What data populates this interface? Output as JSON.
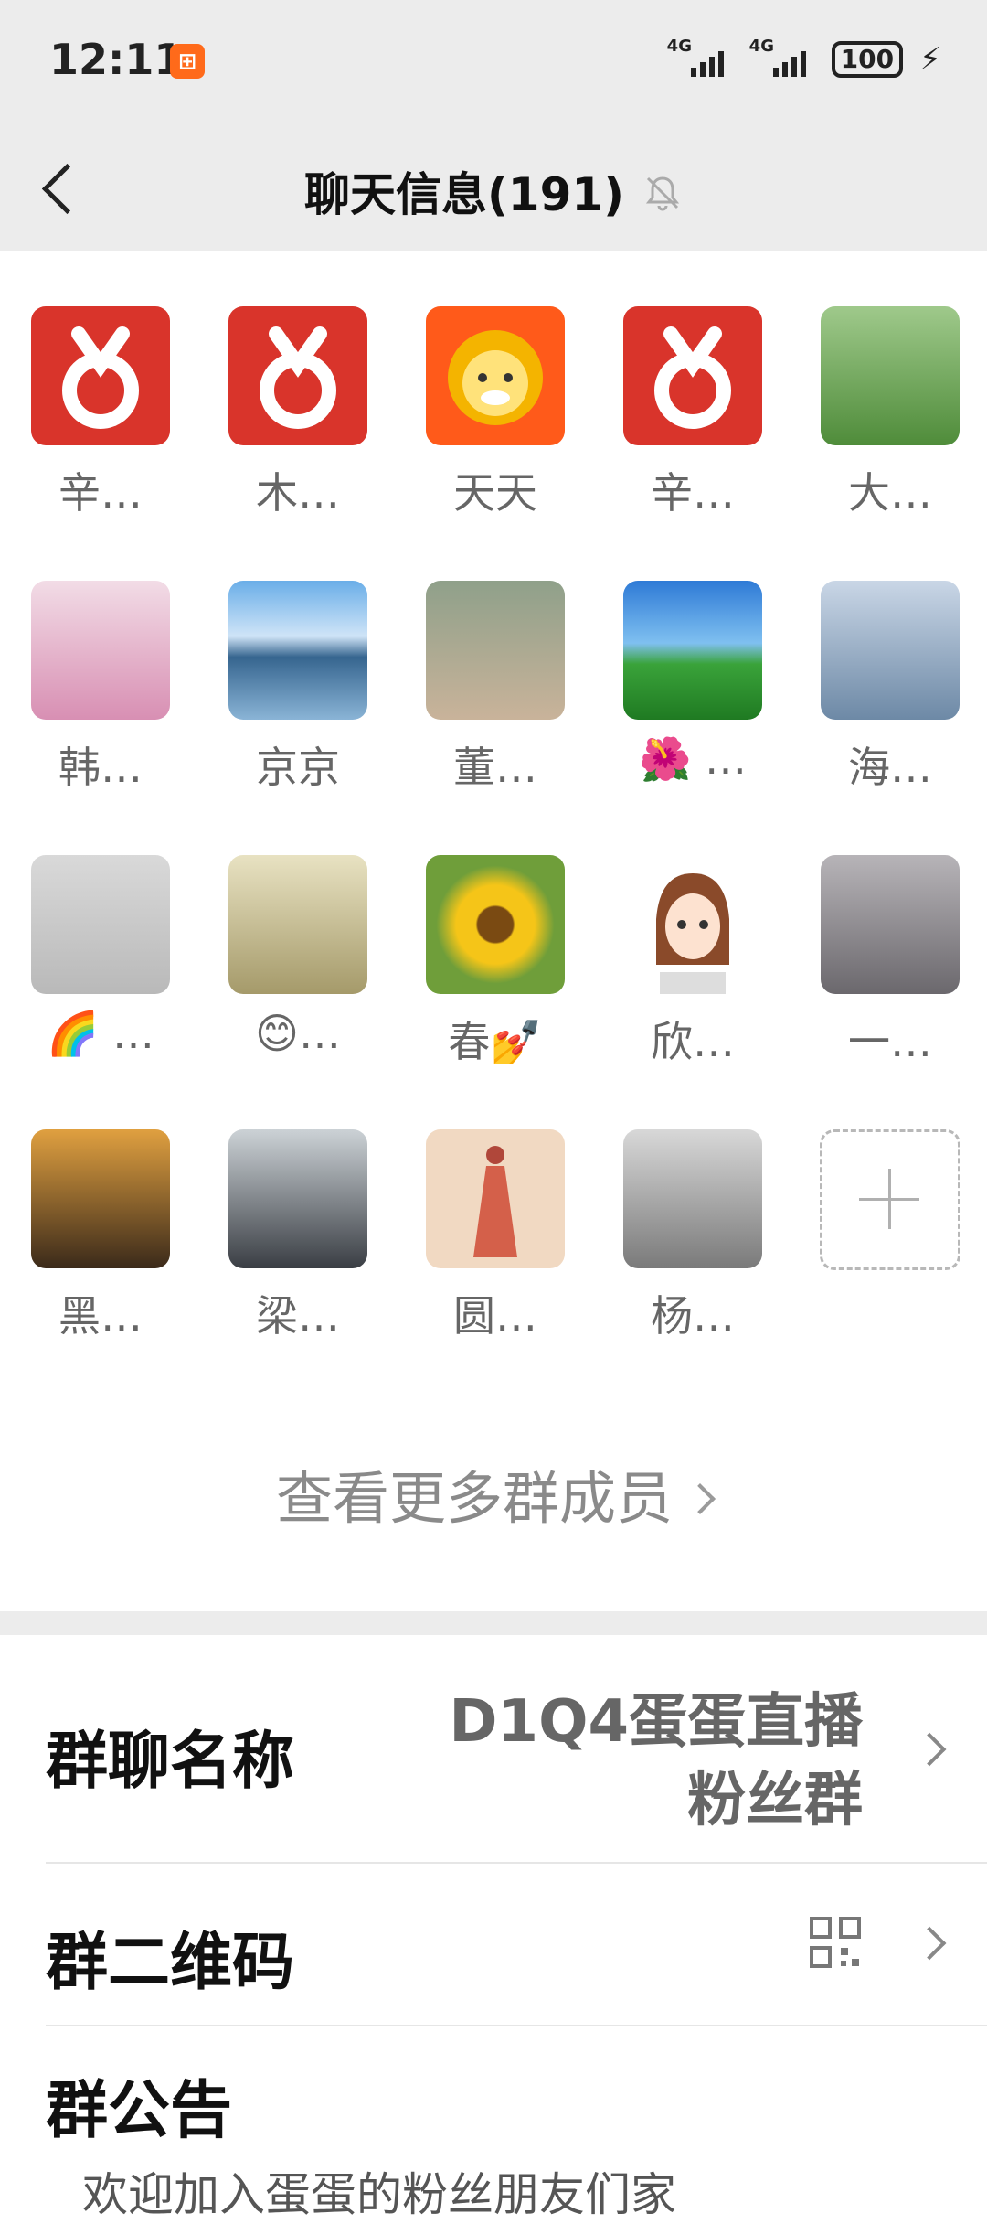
{
  "status_bar": {
    "time": "12:11",
    "network1": "4G",
    "network2": "4G",
    "battery": "100"
  },
  "header": {
    "title": "聊天信息(191)"
  },
  "members": [
    {
      "name": "辛…"
    },
    {
      "name": "木…"
    },
    {
      "name": "天天"
    },
    {
      "name": "辛…"
    },
    {
      "name": "大…"
    },
    {
      "name": "韩…"
    },
    {
      "name": "京京"
    },
    {
      "name": "董…"
    },
    {
      "name": "🌺 …"
    },
    {
      "name": "海…"
    },
    {
      "name": "🌈 …"
    },
    {
      "name": "😊…"
    },
    {
      "name": "春💅"
    },
    {
      "name": "欣…"
    },
    {
      "name": "一…"
    },
    {
      "name": "黑…"
    },
    {
      "name": "梁…"
    },
    {
      "name": "圆…"
    },
    {
      "name": "杨…"
    }
  ],
  "more_members": "查看更多群成员",
  "settings": {
    "group_name_label": "群聊名称",
    "group_name_line1": "D1Q4蛋蛋直播",
    "group_name_line2": "粉丝群",
    "qr_label": "群二维码",
    "notice_label": "群公告",
    "notice_preview": "欢迎加入蛋蛋的粉丝朋友们家"
  }
}
